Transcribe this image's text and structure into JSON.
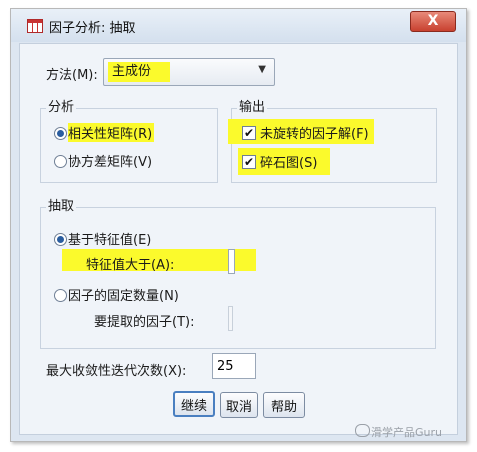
{
  "window": {
    "title": "因子分析: 抽取",
    "close_symbol": "X"
  },
  "method": {
    "label": "方法(M):",
    "value": "主成份"
  },
  "analysis": {
    "legend": "分析",
    "options": [
      {
        "label": "相关性矩阵(R)",
        "selected": true
      },
      {
        "label": "协方差矩阵(V)",
        "selected": false
      }
    ]
  },
  "output": {
    "legend": "输出",
    "options": [
      {
        "label": "未旋转的因子解(F)",
        "checked": true
      },
      {
        "label": "碎石图(S)",
        "checked": true
      }
    ]
  },
  "extract": {
    "legend": "抽取",
    "eigen_option": "基于特征值(E)",
    "eigen_label": "特征值大于(A):",
    "eigen_value": "",
    "fixed_option": "因子的固定数量(N)",
    "fixed_label": "要提取的因子(T):",
    "fixed_value": ""
  },
  "iterations": {
    "label": "最大收敛性迭代次数(X):",
    "value": "25"
  },
  "buttons": {
    "continue": "继续",
    "cancel": "取消",
    "help": "帮助"
  },
  "watermark": "滑学产品Guru",
  "colors": {
    "highlight": "#fbfa2c",
    "close_button": "#c8412f",
    "default_button_border": "#4a7fc0"
  }
}
